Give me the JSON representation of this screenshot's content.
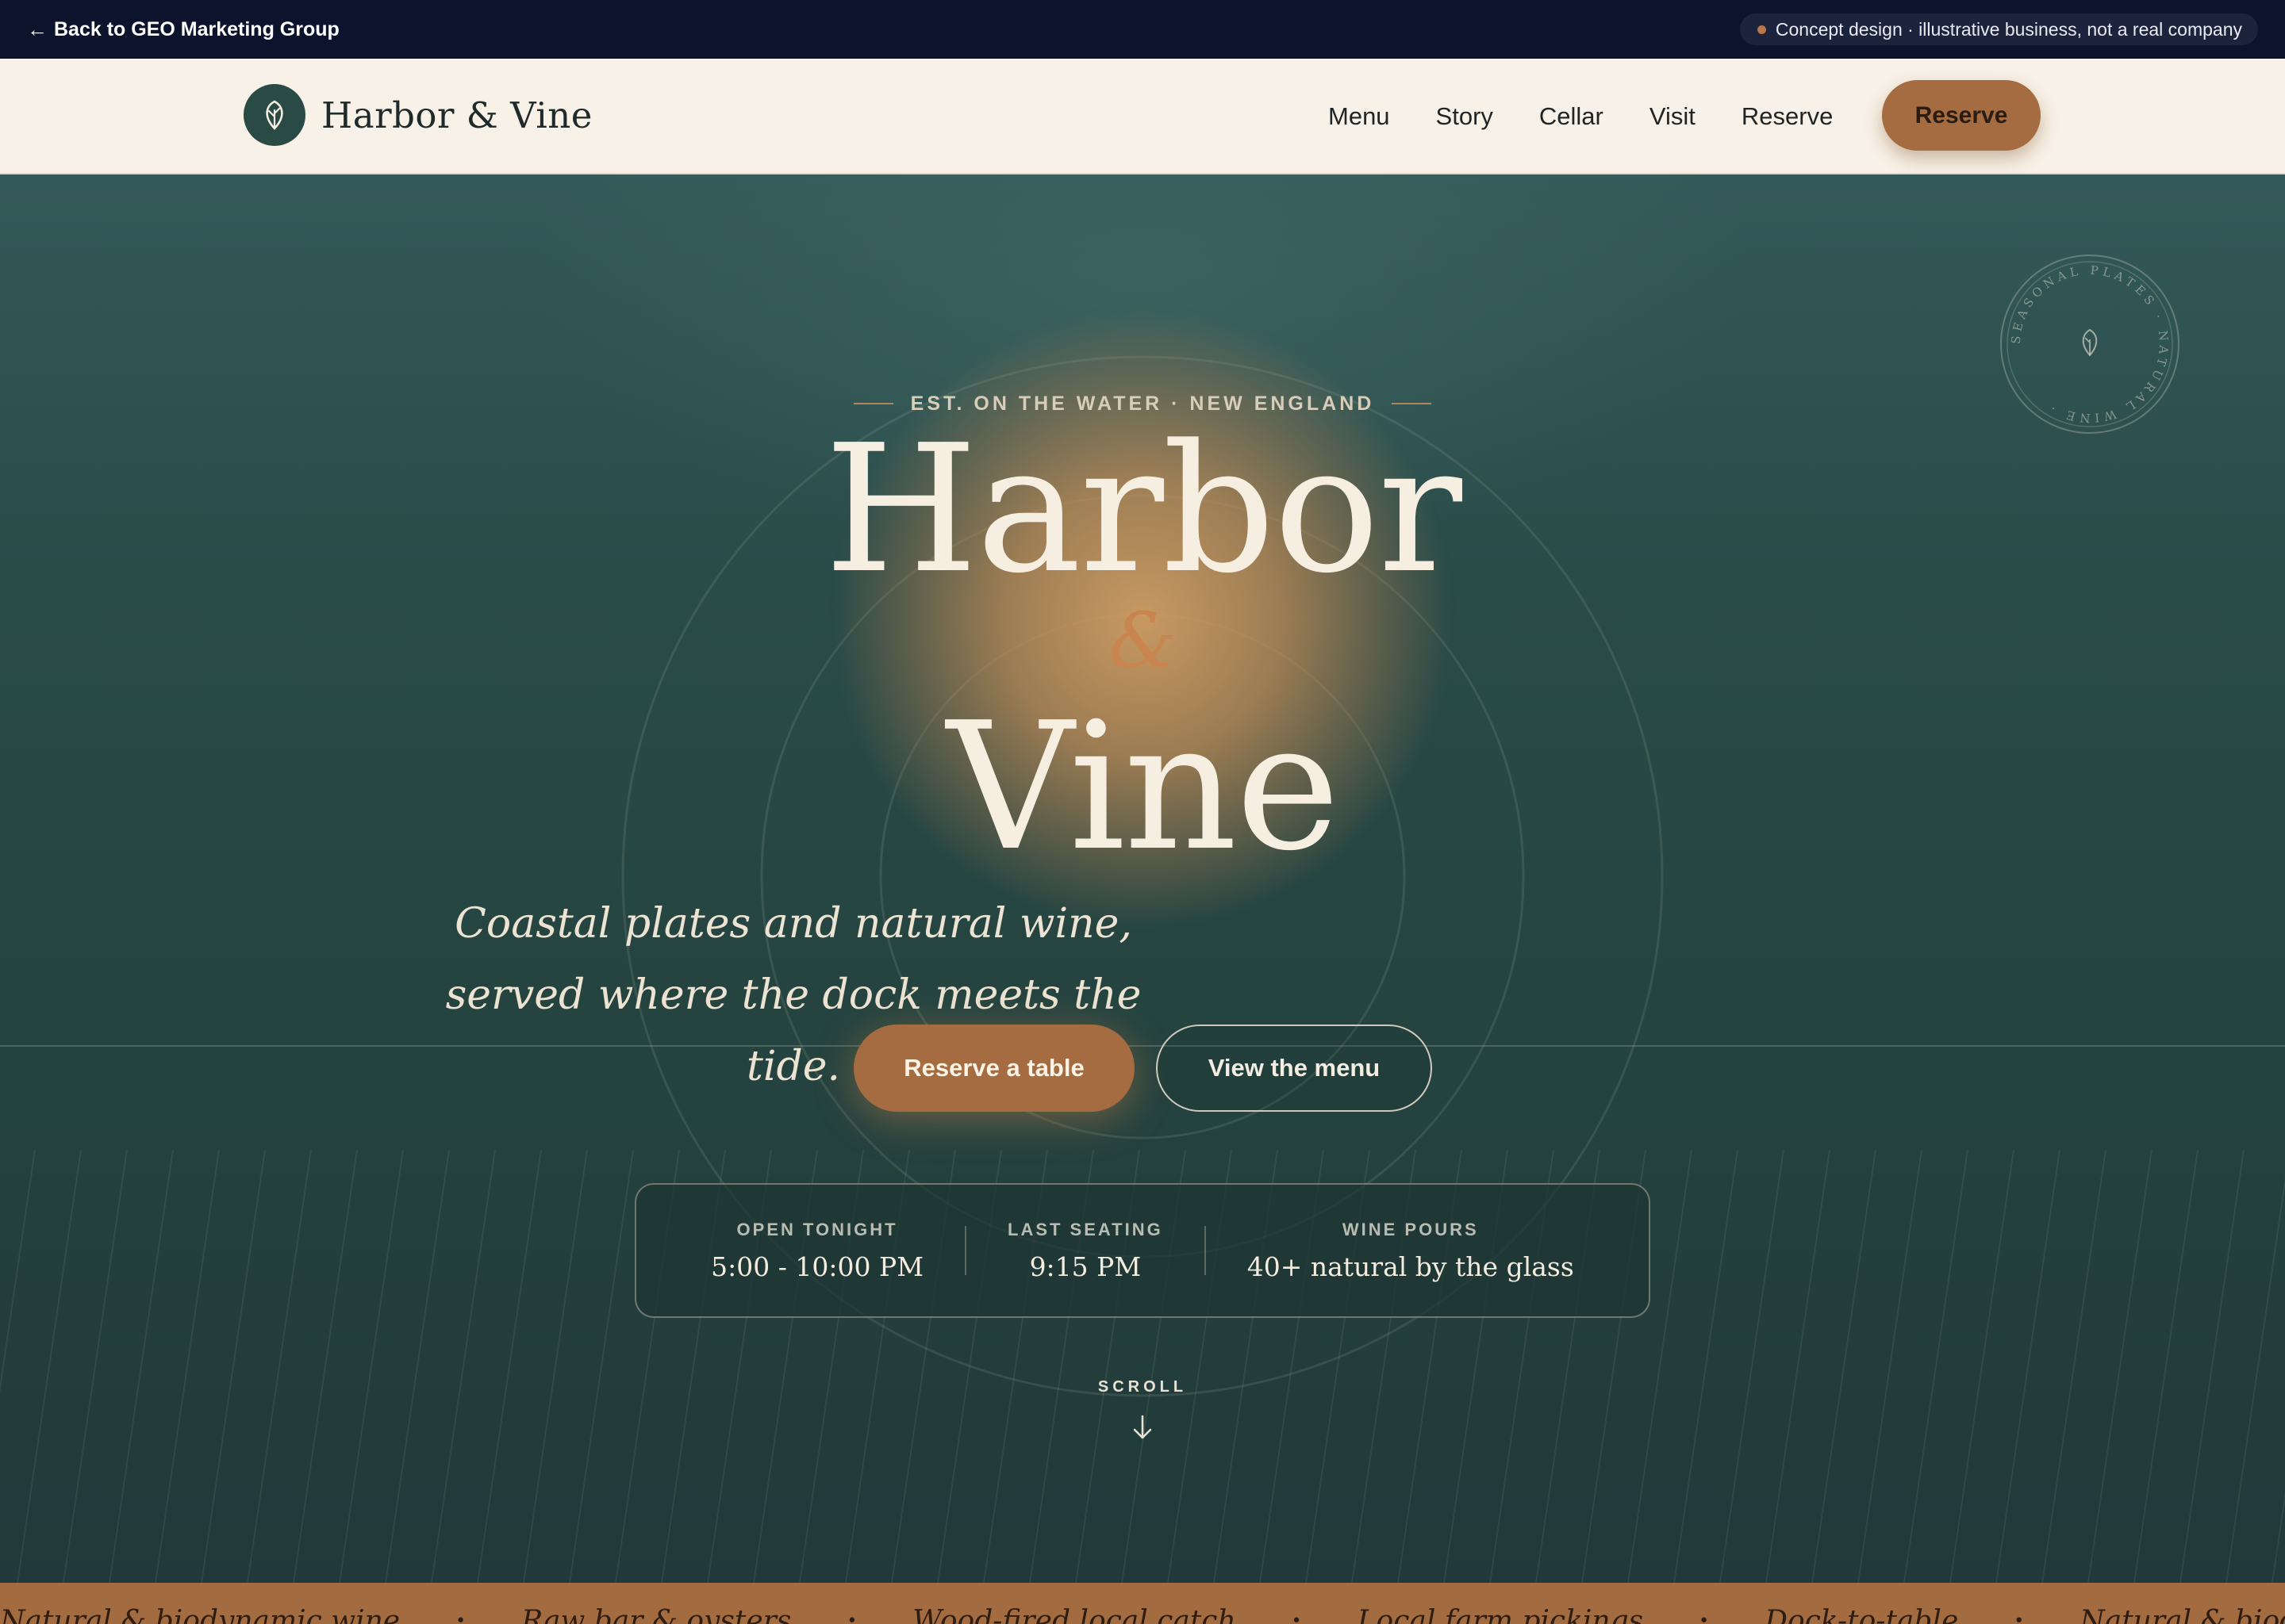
{
  "topstrip": {
    "back_label": "Back to GEO Marketing Group",
    "concept_label": "Concept design  · illustrative business, not a real company"
  },
  "nav": {
    "brand": "Harbor & Vine",
    "links": [
      "Menu",
      "Story",
      "Cellar",
      "Visit",
      "Reserve"
    ],
    "cta_label": "Reserve"
  },
  "hero": {
    "eyebrow": "EST. ON THE WATER · NEW ENGLAND",
    "title_line1": "Harbor",
    "title_amp": "&",
    "title_line2": "Vine",
    "tagline": "Coastal plates and natural wine, served where the dock meets the tide.",
    "primary_cta": "Reserve a table",
    "secondary_cta": "View the menu",
    "seal_text": "SEASONAL PLATES · NATURAL WINE · "
  },
  "hours": [
    {
      "label": "OPEN TONIGHT",
      "value": "5:00 - 10:00 PM"
    },
    {
      "label": "LAST SEATING",
      "value": "9:15 PM"
    },
    {
      "label": "WINE POURS",
      "value": "40+ natural by the glass"
    }
  ],
  "scroll_label": "SCROLL",
  "marquee": {
    "items": [
      "Natural & biodynamic wine",
      "Raw bar & oysters",
      "Wood-fired local catch",
      "Local farm pickings",
      "Dock-to-table",
      "Natural & biodynamic wine"
    ]
  },
  "colors": {
    "accent": "#a46c40",
    "hero_bg": "#254440",
    "cream": "#f8f1e7",
    "topbar": "#0c132c"
  },
  "icons": {
    "back": "arrow-left-icon",
    "logo": "leaf-icon",
    "scroll": "arrow-down-icon"
  }
}
